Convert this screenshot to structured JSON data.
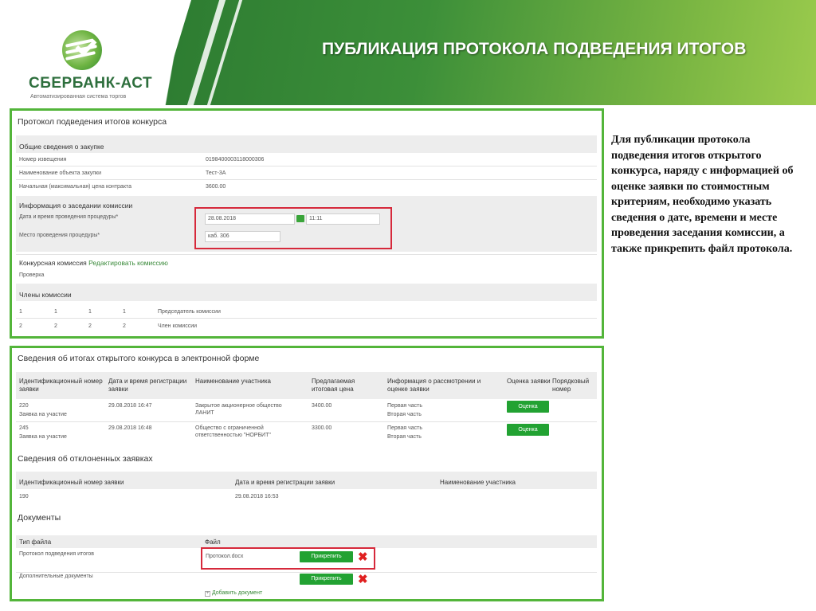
{
  "header": {
    "title": "ПУБЛИКАЦИЯ ПРОТОКОЛА ПОДВЕДЕНИЯ ИТОГОВ",
    "logo_name": "СБЕРБАНК-АСТ",
    "logo_subtitle": "Автоматизированная система торгов",
    "accent_color": "#53b53a"
  },
  "protocol": {
    "title": "Протокол подведения итогов конкурса",
    "general": {
      "heading": "Общие сведения о закупке",
      "notice_label": "Номер извещения",
      "notice_value": "0198400003118000306",
      "object_label": "Наименование объекта закупки",
      "object_value": "Тест-3А",
      "price_label": "Начальная (максимальная) цена контракта",
      "price_value": "3600.00"
    },
    "meeting": {
      "heading": "Информация о заседании комиссии",
      "datetime_label": "Дата и время проведения процедуры*",
      "date_value": "28.08.2018",
      "time_value": "11:11",
      "place_label": "Место проведения процедуры*",
      "place_value": "каб. 306"
    },
    "commission": {
      "label": "Конкурсная комиссия",
      "edit_link": "Редактировать комиссию",
      "name": "Проверка"
    },
    "members": {
      "heading": "Члены комиссии",
      "rows": [
        {
          "c1": "1",
          "c2": "1",
          "c3": "1",
          "c4": "1",
          "role": "Председатель комиссии"
        },
        {
          "c1": "2",
          "c2": "2",
          "c3": "2",
          "c4": "2",
          "role": "Член комиссии"
        }
      ]
    }
  },
  "results": {
    "title": "Сведения об итогах открытого конкурса в электронной форме",
    "headers": {
      "id": "Идентификационный номер заявки",
      "date": "Дата и время регистрации заявки",
      "name": "Наименование участника",
      "price": "Предлагаемая итоговая цена",
      "info": "Информация о рассмотрении и оценке заявки",
      "rating": "Оценка заявки",
      "order": "Порядковый номер"
    },
    "rows": [
      {
        "id": "220",
        "app_link": "Заявка на участие",
        "date": "29.08.2018 16:47",
        "name": "Закрытое акционерное общество ЛАНИТ",
        "price": "3400.00",
        "part1": "Первая часть",
        "part2": "Вторая часть",
        "button": "Оценка"
      },
      {
        "id": "245",
        "app_link": "Заявка на участие",
        "date": "29.08.2018 16:48",
        "name": "Общество с ограниченной ответственностью \"НОРБИТ\"",
        "price": "3300.00",
        "part1": "Первая часть",
        "part2": "Вторая часть",
        "button": "Оценка"
      }
    ],
    "rejected": {
      "title": "Сведения об отклоненных заявках",
      "headers": {
        "id": "Идентификационный номер заявки",
        "date": "Дата и время регистрации заявки",
        "name": "Наименование участника"
      },
      "row": {
        "id": "190",
        "date": "29.08.2018 16:53",
        "name": ""
      }
    },
    "documents": {
      "title": "Документы",
      "type_header": "Тип файла",
      "file_header": "Файл",
      "row1_type": "Протокол подведения итогов",
      "row1_file": "Протокол.docx",
      "row2_type": "Дополнительные документы",
      "attach_label": "Прикрепить",
      "add_document": "Добавить документ"
    }
  },
  "side_text": "Для публикации протокола подведения итогов открытого конкурса, наряду с информацией об оценке заявки по стоимостным критериям, необходимо указать сведения о дате, времени и месте проведения заседания комиссии, а также прикрепить файл протокола."
}
